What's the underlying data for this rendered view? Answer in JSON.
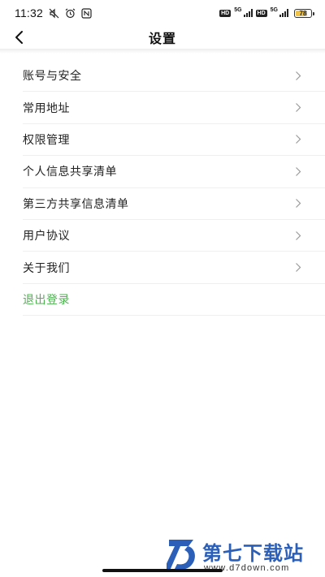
{
  "status_bar": {
    "time": "11:32",
    "left_icons": [
      "muted-icon",
      "alarm-icon",
      "nfc-icon"
    ],
    "sim_badge": "HD",
    "network": "5G",
    "battery": "78",
    "battery_level": 0.78
  },
  "nav": {
    "title": "设置",
    "back_icon": "chevron-left-icon"
  },
  "settings": {
    "items": [
      {
        "label": "账号与安全"
      },
      {
        "label": "常用地址"
      },
      {
        "label": "权限管理"
      },
      {
        "label": "个人信息共享清单"
      },
      {
        "label": "第三方共享信息清单"
      },
      {
        "label": "用户协议"
      },
      {
        "label": "关于我们"
      }
    ],
    "logout_label": "退出登录",
    "chevron_icon": "chevron-right-icon"
  },
  "colors": {
    "logout": "#4cb34f",
    "watermark": "#2b5fb8"
  },
  "watermark": {
    "title": "第七下载站",
    "url": "www.d7down.com"
  }
}
